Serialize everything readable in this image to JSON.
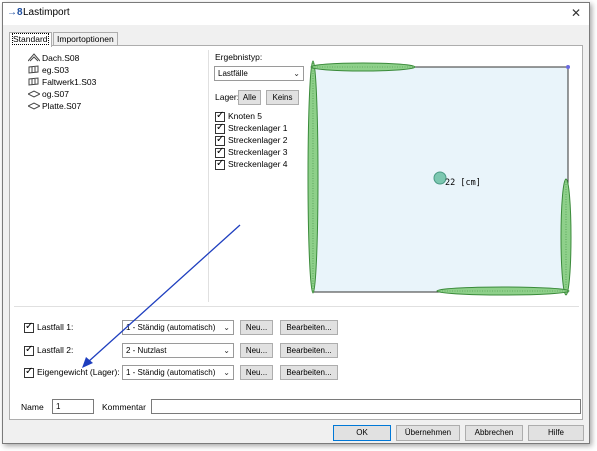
{
  "window": {
    "title": "Lastimport",
    "icon": "import-arrow-icon"
  },
  "tabs": [
    {
      "label": "Standard",
      "active": true
    },
    {
      "label": "Importoptionen",
      "active": false
    }
  ],
  "tree": [
    {
      "label": "Dach.S08",
      "icon": "roof-icon"
    },
    {
      "label": "eg.S03",
      "icon": "wall-icon"
    },
    {
      "label": "Faltwerk1.S03",
      "icon": "wall-icon"
    },
    {
      "label": "og.S07",
      "icon": "slab-icon"
    },
    {
      "label": "Platte.S07",
      "icon": "slab-icon"
    }
  ],
  "ergebnistyp": {
    "label": "Ergebnistyp:",
    "value": "Lastfälle"
  },
  "lager": {
    "label": "Lager:",
    "all_button": "Alle",
    "none_button": "Keins",
    "items": [
      {
        "label": "Knoten 5",
        "checked": true
      },
      {
        "label": "Streckenlager 1",
        "checked": true
      },
      {
        "label": "Streckenlager 2",
        "checked": true
      },
      {
        "label": "Streckenlager 3",
        "checked": true
      },
      {
        "label": "Streckenlager 4",
        "checked": true
      }
    ]
  },
  "preview": {
    "dimension_label": "22 [cm]"
  },
  "lastfaelle": [
    {
      "label": "Lastfall 1:",
      "checked": true,
      "value": "1 - Ständig (automatisch)",
      "new_button": "Neu...",
      "edit_button": "Bearbeiten..."
    },
    {
      "label": "Lastfall 2:",
      "checked": true,
      "value": "2 - Nutzlast",
      "new_button": "Neu...",
      "edit_button": "Bearbeiten..."
    },
    {
      "label": "Eigengewicht (Lager):",
      "checked": true,
      "value": "1 - Ständig (automatisch)",
      "new_button": "Neu...",
      "edit_button": "Bearbeiten..."
    }
  ],
  "name": {
    "label": "Name",
    "value": "1"
  },
  "kommentar": {
    "label": "Kommentar",
    "value": ""
  },
  "footer": {
    "ok": "OK",
    "apply": "Übernehmen",
    "cancel": "Abbrechen",
    "help": "Hilfe"
  },
  "colors": {
    "plate_fill": "#e9f4fa",
    "support_fill": "#8ed08a",
    "support_stroke": "#3a8a3a",
    "node": "#7cc7b0",
    "annotation_arrow": "#1f3fbf",
    "focus_border": "#0078d7"
  }
}
